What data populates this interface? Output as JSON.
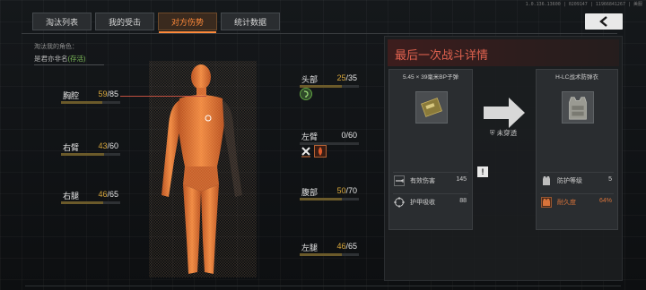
{
  "version": "1.0.136.13600 | 0209147 | 11966841267 | 美服",
  "tabs": [
    {
      "label": "淘汰列表"
    },
    {
      "label": "我的受击"
    },
    {
      "label": "对方伤势"
    },
    {
      "label": "统计数据"
    }
  ],
  "killer": {
    "label": "淘汰我的角色：",
    "name": "是君亦非名",
    "status": "(存活)"
  },
  "parts": {
    "chest": {
      "name": "胸腔",
      "cur": "59",
      "max": "/85",
      "ratio": 0.69
    },
    "right_arm": {
      "name": "右臂",
      "cur": "43",
      "max": "/60",
      "ratio": 0.72
    },
    "right_leg": {
      "name": "右腿",
      "cur": "46",
      "max": "/65",
      "ratio": 0.71
    },
    "head": {
      "name": "头部",
      "cur": "25",
      "max": "/35",
      "ratio": 0.71
    },
    "left_arm": {
      "name": "左臂",
      "cur": "0",
      "max": "/60",
      "ratio": 0.0
    },
    "stomach": {
      "name": "腹部",
      "cur": "50",
      "max": "/70",
      "ratio": 0.71
    },
    "left_leg": {
      "name": "左腿",
      "cur": "46",
      "max": "/65",
      "ratio": 0.71
    }
  },
  "detail": {
    "title": "最后一次战斗详情",
    "ammo": {
      "name": "5.45 × 39毫米BP子弹",
      "stats": [
        {
          "label": "有效伤害",
          "value": "145",
          "icon": "bullet-icon"
        },
        {
          "label": "护甲吸收",
          "value": "88",
          "icon": "crosshair-icon"
        }
      ]
    },
    "armor": {
      "name": "H-LC战术防弹衣",
      "stats": [
        {
          "label": "防护等级",
          "value": "5",
          "icon": "vest-icon"
        },
        {
          "label": "耐久度",
          "value": "64%",
          "icon": "durability-icon"
        }
      ]
    },
    "result": "未穿透",
    "alert": "!"
  },
  "colors": {
    "accent": "#ff8a3a",
    "title_red": "#e0624f",
    "hp_value": "#d6a53a",
    "survived": "#7fbf5a",
    "body": "#e07a3a"
  }
}
